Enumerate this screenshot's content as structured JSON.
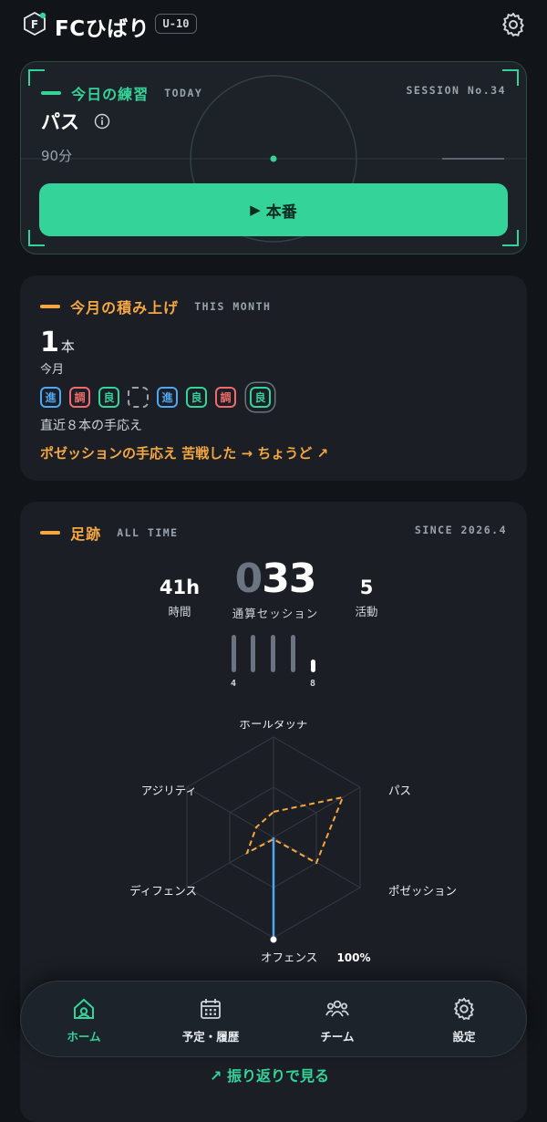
{
  "header": {
    "logo_letter": "F",
    "app_name": "FCひばり",
    "age_group": "U-10",
    "settings_icon": "gear-icon"
  },
  "today": {
    "section_title": "今日の練習",
    "section_sub": "TODAY",
    "session_no": "SESSION No.34",
    "menu_title": "パス",
    "duration": "90分",
    "start_label": "本番",
    "start_icon": "▶",
    "accent": "#34d399"
  },
  "month": {
    "section_title": "今月の積み上げ",
    "section_sub": "THIS MONTH",
    "count": "1",
    "count_unit": "本",
    "count_label": "今月",
    "chips": [
      {
        "text": "進",
        "kind": "blue"
      },
      {
        "text": "調",
        "kind": "red"
      },
      {
        "text": "良",
        "kind": "green"
      },
      {
        "text": "",
        "kind": "empty"
      },
      {
        "text": "進",
        "kind": "blue"
      },
      {
        "text": "良",
        "kind": "green"
      },
      {
        "text": "調",
        "kind": "red"
      },
      {
        "text": "良",
        "kind": "green"
      }
    ],
    "chips_caption": "直近８本の手応え",
    "insight": "ポゼッションの手応え 苦戦した → ちょうど ↗",
    "accent": "#f5a742"
  },
  "all_time": {
    "section_title": "足跡",
    "section_sub": "ALL TIME",
    "since": "SINCE 2026.4",
    "hours": "41h",
    "hours_label": "時間",
    "sessions_ghost": "0",
    "sessions": "33",
    "sessions_label": "通算セッション",
    "activities": "5",
    "activities_label": "活動",
    "tally_labels": [
      "4",
      "8"
    ],
    "radar": {
      "axes": [
        "ボールタッチ",
        "パス",
        "ポゼッション",
        "オフェンス",
        "ディフェンス",
        "アジリティ"
      ],
      "highlight_value": "100%"
    },
    "review_link": "振り返りで見る"
  },
  "nav": {
    "items": [
      {
        "label": "ホーム",
        "icon": "home-icon",
        "active": true
      },
      {
        "label": "予定・履歴",
        "icon": "calendar-icon",
        "active": false
      },
      {
        "label": "チーム",
        "icon": "team-icon",
        "active": false
      },
      {
        "label": "設定",
        "icon": "gear-icon",
        "active": false
      }
    ]
  }
}
